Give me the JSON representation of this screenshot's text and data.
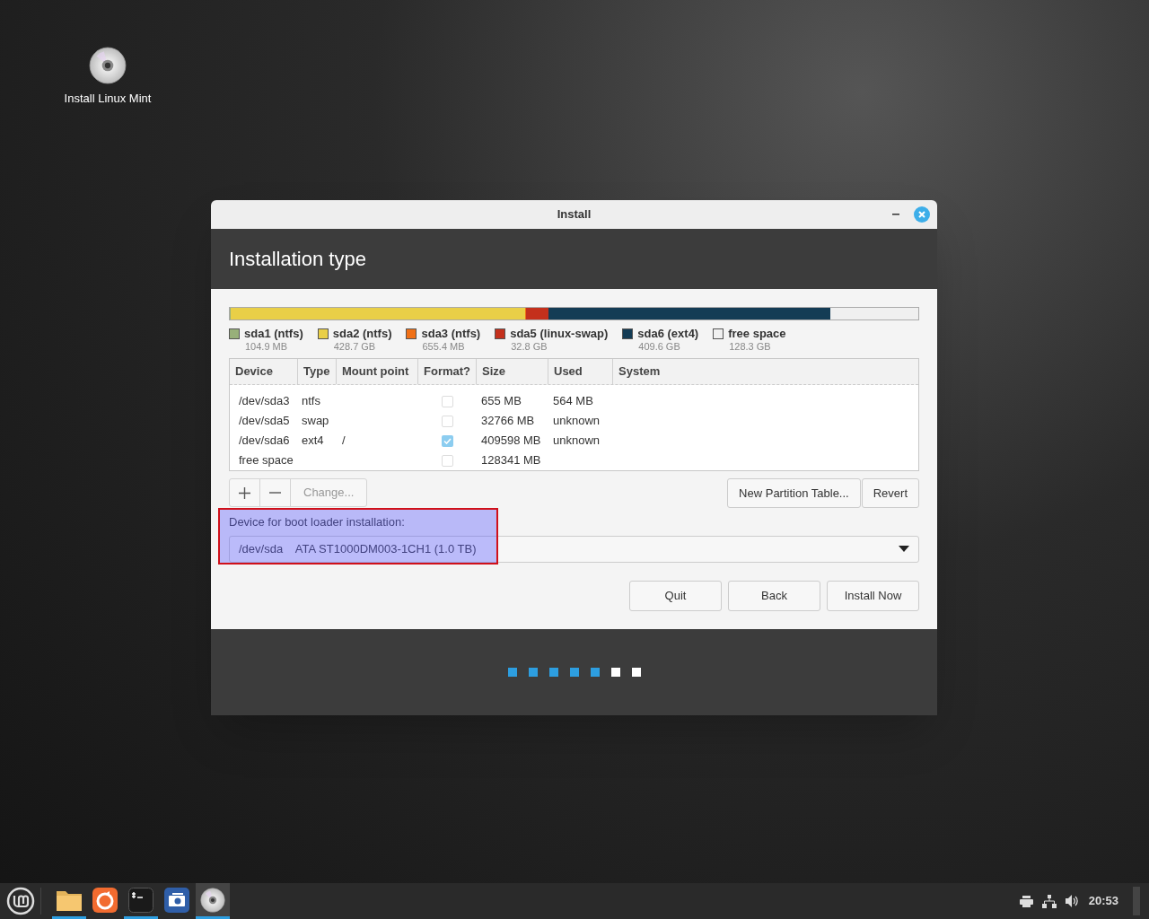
{
  "desktop_icon": {
    "label": "Install Linux Mint"
  },
  "window": {
    "title": "Install"
  },
  "header": {
    "title": "Installation type"
  },
  "partitions": [
    {
      "name": "sda1 (ntfs)",
      "size": "104.9 MB",
      "color": "#98b07a"
    },
    {
      "name": "sda2 (ntfs)",
      "size": "428.7 GB",
      "color": "#e9cf47"
    },
    {
      "name": "sda3 (ntfs)",
      "size": "655.4 MB",
      "color": "#f07016"
    },
    {
      "name": "sda5 (linux-swap)",
      "size": "32.8 GB",
      "color": "#c4301c"
    },
    {
      "name": "sda6 (ext4)",
      "size": "409.6 GB",
      "color": "#143c55"
    },
    {
      "name": "free space",
      "size": "128.3 GB",
      "color": "#f0f0f0"
    }
  ],
  "table": {
    "columns": [
      "Device",
      "Type",
      "Mount point",
      "Format?",
      "Size",
      "Used",
      "System"
    ],
    "rows": [
      {
        "device": "/dev/sda3",
        "type": "ntfs",
        "mount": "",
        "format": false,
        "size": "655 MB",
        "used": "564 MB"
      },
      {
        "device": "/dev/sda5",
        "type": "swap",
        "mount": "",
        "format": false,
        "size": "32766 MB",
        "used": "unknown"
      },
      {
        "device": "/dev/sda6",
        "type": "ext4",
        "mount": "/",
        "format": true,
        "size": "409598 MB",
        "used": "unknown"
      },
      {
        "device": "free space",
        "type": "",
        "mount": "",
        "format": false,
        "size": "128341 MB",
        "used": ""
      }
    ]
  },
  "partition_buttons": {
    "change": "Change...",
    "new_table": "New Partition Table...",
    "revert": "Revert"
  },
  "boot_loader": {
    "label": "Device for boot loader installation:",
    "value": "/dev/sda    ATA ST1000DM003-1CH1 (1.0 TB)"
  },
  "buttons": [
    "Quit",
    "Back",
    "Install Now"
  ],
  "steps": [
    {
      "done": true
    },
    {
      "done": true
    },
    {
      "done": true
    },
    {
      "done": true
    },
    {
      "done": true
    },
    {
      "done": false
    },
    {
      "done": false
    }
  ],
  "taskbar": {
    "apps": [
      {
        "kind": "folder",
        "running": true,
        "selected": false
      },
      {
        "kind": "browser",
        "running": false,
        "selected": false
      },
      {
        "kind": "terminal",
        "running": true,
        "selected": false
      },
      {
        "kind": "camera",
        "running": false,
        "selected": false
      },
      {
        "kind": "disc",
        "running": true,
        "selected": true
      }
    ],
    "clock": "20:53"
  }
}
